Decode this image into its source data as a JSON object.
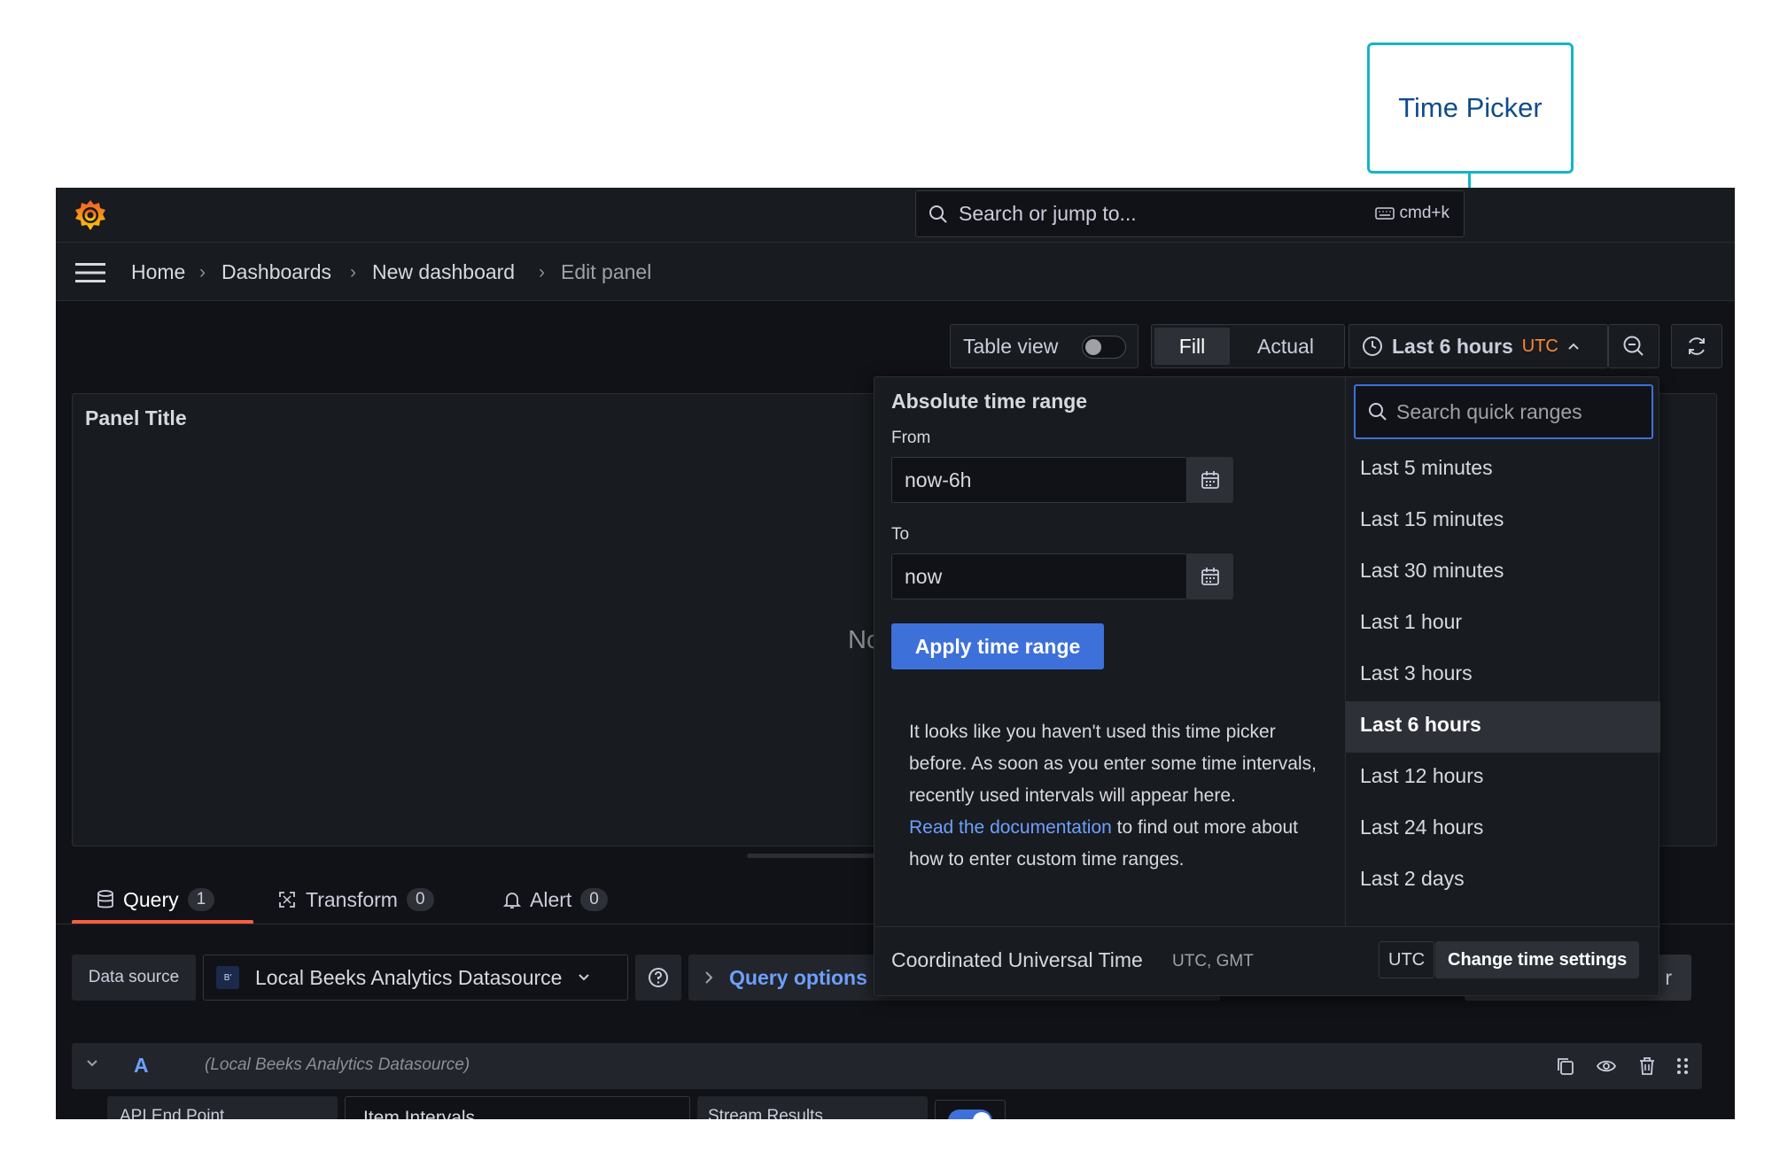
{
  "annotation": {
    "label": "Time Picker"
  },
  "topbar": {
    "search_placeholder": "Search or jump to...",
    "search_shortcut": "cmd+k"
  },
  "breadcrumb": {
    "items": [
      "Home",
      "Dashboards",
      "New dashboard",
      "Edit panel"
    ]
  },
  "toolbar": {
    "table_view_label": "Table view",
    "fill_label": "Fill",
    "actual_label": "Actual",
    "time_range_label": "Last 6 hours",
    "timezone_badge": "UTC"
  },
  "panel": {
    "title": "Panel Title",
    "no_data_partial": "No"
  },
  "tabs": [
    {
      "label": "Query",
      "count": "1"
    },
    {
      "label": "Transform",
      "count": "0"
    },
    {
      "label": "Alert",
      "count": "0"
    }
  ],
  "datasource": {
    "label": "Data source",
    "selected": "Local Beeks Analytics Datasource",
    "icon_text": "B'",
    "query_options_label": "Query options",
    "query_inspector_partial": "r"
  },
  "query_row": {
    "letter": "A",
    "datasource_note": "(Local Beeks Analytics Datasource)",
    "api_label": "API End Point",
    "api_value": "Item Intervals",
    "stream_label": "Stream Results"
  },
  "time_picker": {
    "absolute_title": "Absolute time range",
    "from_label": "From",
    "from_value": "now-6h",
    "to_label": "To",
    "to_value": "now",
    "apply_label": "Apply time range",
    "info_text": "It looks like you haven't used this time picker before. As soon as you enter some time intervals, recently used intervals will appear here.",
    "doc_link": "Read the documentation",
    "doc_suffix": " to find out more about how to enter custom time ranges.",
    "quick_search_placeholder": "Search quick ranges",
    "quick_ranges": [
      "Last 5 minutes",
      "Last 15 minutes",
      "Last 30 minutes",
      "Last 1 hour",
      "Last 3 hours",
      "Last 6 hours",
      "Last 12 hours",
      "Last 24 hours",
      "Last 2 days"
    ],
    "selected_range": "Last 6 hours",
    "timezone_name": "Coordinated Universal Time",
    "timezone_abbr": "UTC, GMT",
    "timezone_badge": "UTC",
    "change_settings_label": "Change time settings"
  }
}
